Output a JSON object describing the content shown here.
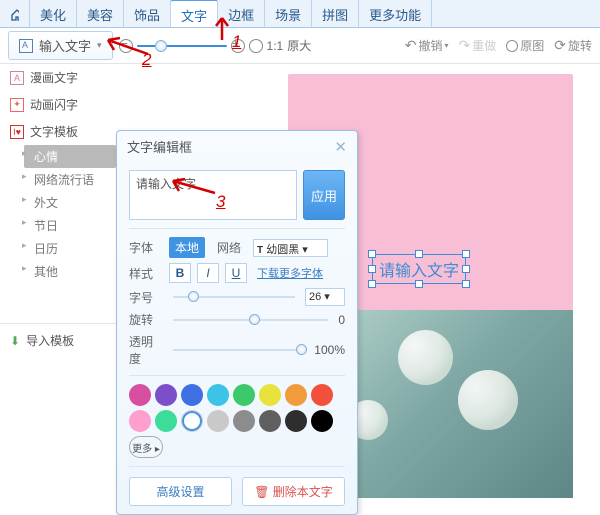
{
  "tabs": [
    "美化",
    "美容",
    "饰品",
    "文字",
    "边框",
    "场景",
    "拼图",
    "更多功能"
  ],
  "active_tab_index": 3,
  "toolbar": {
    "input_text": "输入文字",
    "zoom_reset": "1:1",
    "zoom_original": "原大",
    "undo": "撤销",
    "redo": "重做",
    "orig": "原图",
    "rotate": "旋转"
  },
  "sidebar": {
    "manhua": "漫画文字",
    "anim": "动画闪字",
    "template": "文字模板",
    "sub": [
      "心情",
      "网络流行语",
      "外文",
      "节日",
      "日历",
      "其他"
    ],
    "active_sub_index": 0,
    "import": "导入模板"
  },
  "dialog": {
    "title": "文字编辑框",
    "textarea_value": "请输入文字",
    "apply": "应用",
    "font_label": "字体",
    "font_tab_local": "本地",
    "font_tab_net": "网络",
    "font_select": "幼圆黑",
    "style_label": "样式",
    "more_fonts": "下载更多字体",
    "b": "B",
    "i": "I",
    "u": "U",
    "size_label": "字号",
    "size_value": "26",
    "rotate_label": "旋转",
    "rotate_value": "0",
    "opacity_label": "透明度",
    "opacity_value": "100%",
    "colors": [
      "#d94fa0",
      "#7b4fc9",
      "#3f6fe3",
      "#3cc3e8",
      "#3cc96b",
      "#e8e23c",
      "#f29b3c",
      "#f24f3c",
      "#ff9fcf",
      "#3cdc9b",
      "#ffffff",
      "#c9c9c9",
      "#8c8c8c",
      "#5f5f5f",
      "#2e2e2e",
      "#000000"
    ],
    "selected_color_index": 10,
    "more": "更多",
    "advanced": "高级设置",
    "delete": "删除本文字"
  },
  "canvas": {
    "placeholder_text": "请输入文字"
  },
  "annotations": {
    "a1": "1",
    "a2": "2",
    "a3": "3"
  }
}
